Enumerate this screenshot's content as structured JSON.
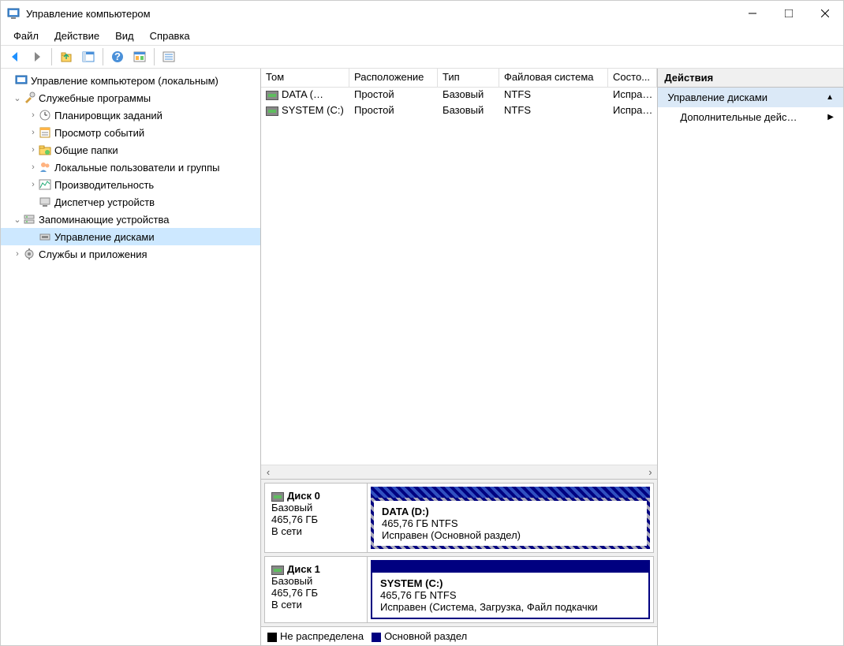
{
  "window": {
    "title": "Управление компьютером"
  },
  "menu": {
    "file": "Файл",
    "action": "Действие",
    "view": "Вид",
    "help": "Справка"
  },
  "tree": {
    "root": "Управление компьютером (локальным)",
    "system_tools": "Служебные программы",
    "task_scheduler": "Планировщик заданий",
    "event_viewer": "Просмотр событий",
    "shared_folders": "Общие папки",
    "local_users": "Локальные пользователи и группы",
    "performance": "Производительность",
    "device_manager": "Диспетчер устройств",
    "storage": "Запоминающие устройства",
    "disk_management": "Управление дисками",
    "services": "Службы и приложения"
  },
  "table": {
    "headers": {
      "volume": "Том",
      "layout": "Расположение",
      "type": "Тип",
      "fs": "Файловая система",
      "status": "Состо..."
    },
    "rows": [
      {
        "volume": "DATA (…",
        "layout": "Простой",
        "type": "Базовый",
        "fs": "NTFS",
        "status": "Испра…"
      },
      {
        "volume": "SYSTEM (C:)",
        "layout": "Простой",
        "type": "Базовый",
        "fs": "NTFS",
        "status": "Испра…"
      }
    ]
  },
  "disks": [
    {
      "name": "Диск 0",
      "type": "Базовый",
      "size": "465,76 ГБ",
      "status": "В сети",
      "partition": {
        "name": "DATA  (D:)",
        "size": "465,76 ГБ NTFS",
        "status": "Исправен (Основной раздел)",
        "hatched": true
      }
    },
    {
      "name": "Диск 1",
      "type": "Базовый",
      "size": "465,76 ГБ",
      "status": "В сети",
      "partition": {
        "name": "SYSTEM  (C:)",
        "size": "465,76 ГБ NTFS",
        "status": "Исправен (Система, Загрузка, Файл подкачки",
        "hatched": false
      }
    }
  ],
  "legend": {
    "unallocated": "Не распределена",
    "primary": "Основной раздел"
  },
  "actions": {
    "header": "Действия",
    "disk_mgmt": "Управление дисками",
    "more": "Дополнительные дейс…"
  }
}
